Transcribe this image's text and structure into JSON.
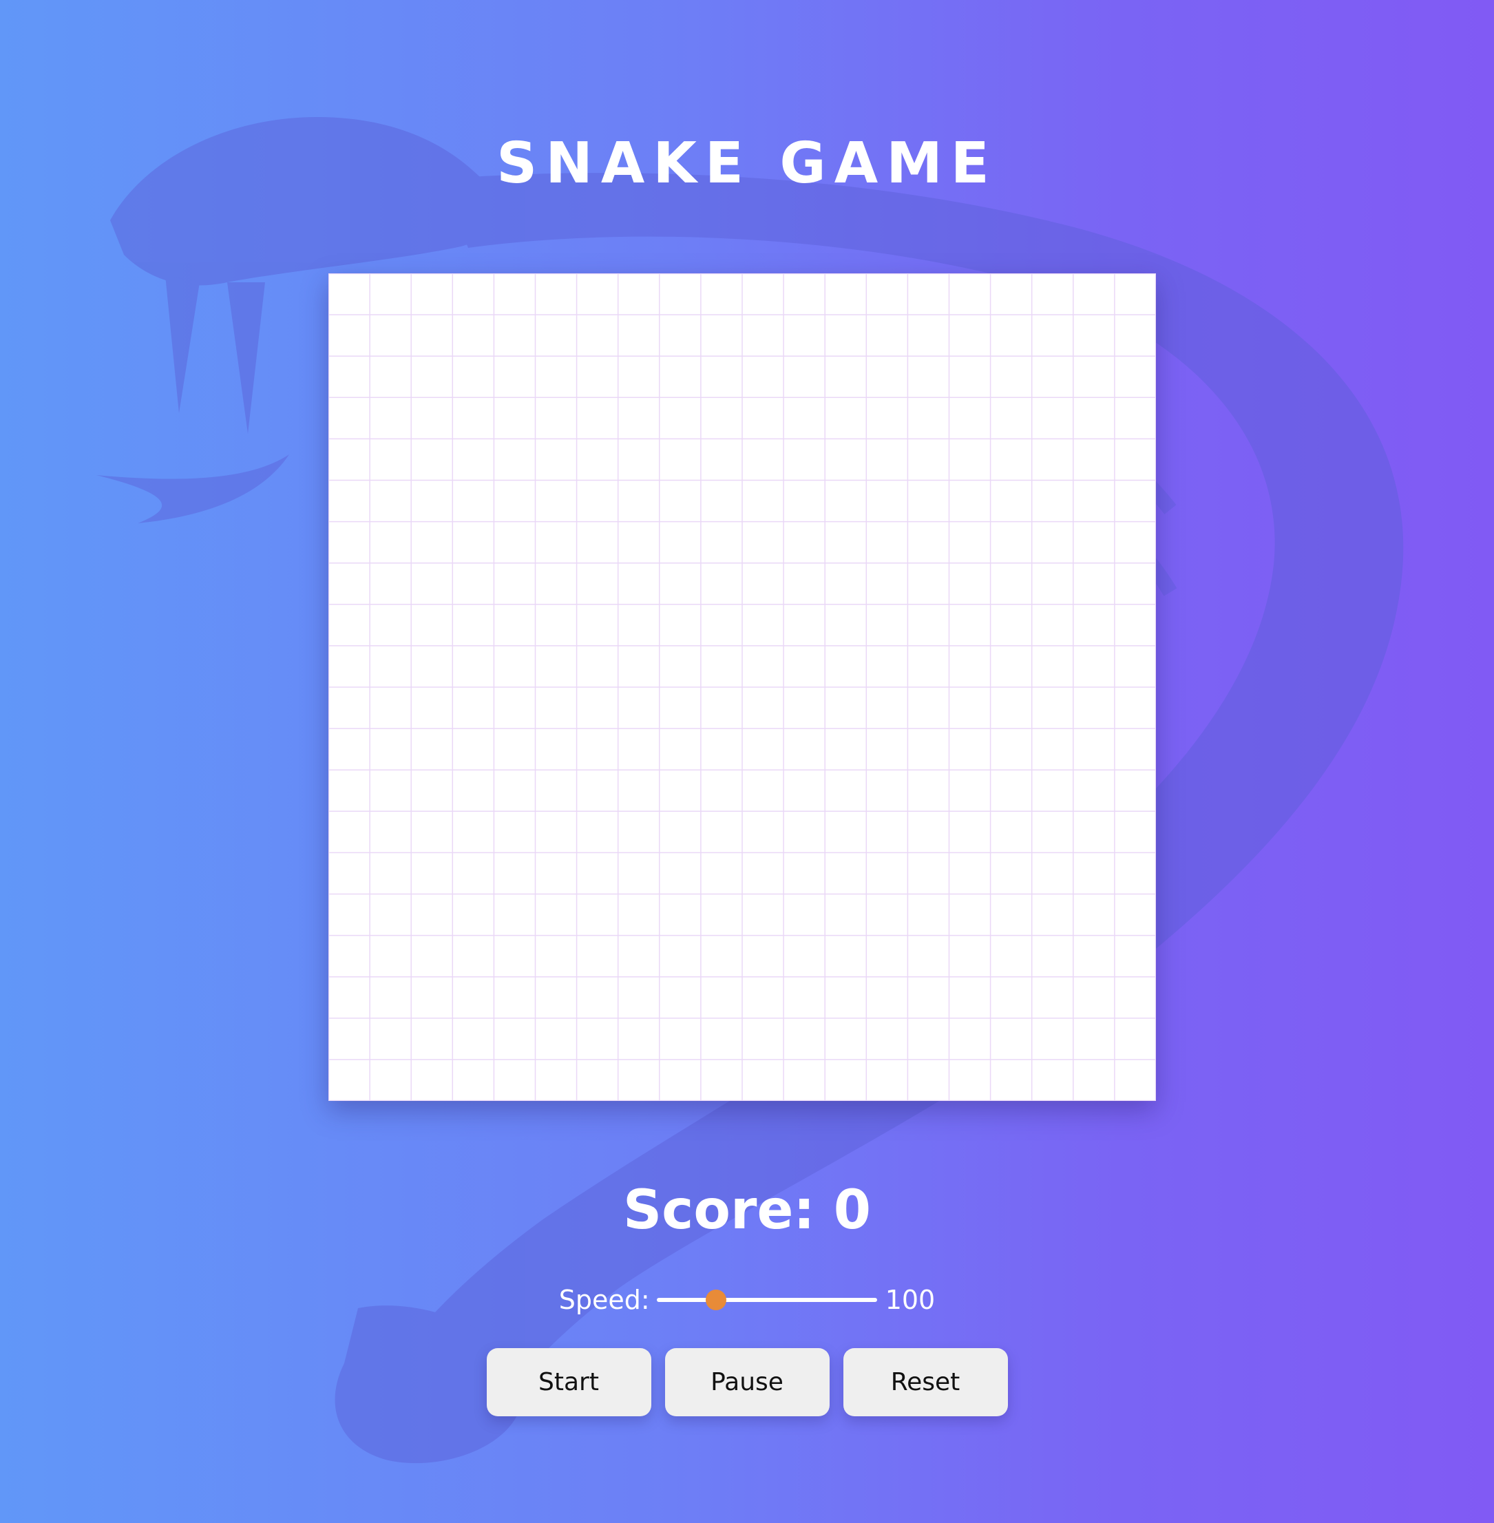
{
  "game": {
    "title": "SNAKE GAME",
    "board": {
      "rows": 20,
      "cols": 20,
      "background_color": "#ffffff",
      "grid_line_color": "#ead8f7"
    },
    "score_text": "Score: 0",
    "speed": {
      "label": "Speed:",
      "value": "100",
      "slider_fraction": 0.27,
      "thumb_color": "#e88b38"
    },
    "buttons": {
      "start": "Start",
      "pause": "Pause",
      "reset": "Reset"
    }
  },
  "theme": {
    "gradient_start": "#6197f8",
    "gradient_end": "#815af4",
    "background_emblem": "cobra-icon"
  }
}
